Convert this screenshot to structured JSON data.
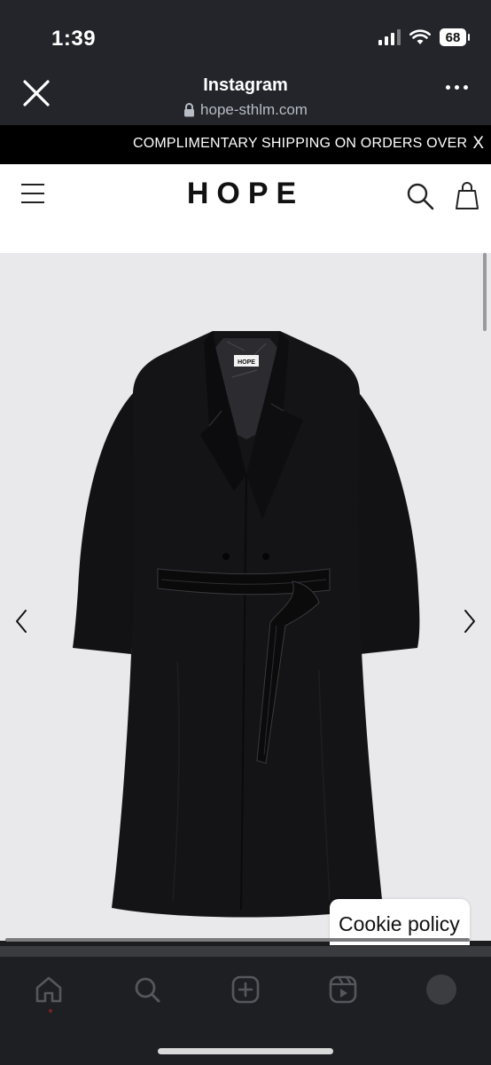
{
  "status_bar": {
    "time": "1:39",
    "battery": "68",
    "signal_icon": "cellular-signal-icon",
    "wifi_icon": "wifi-icon"
  },
  "browser_bar": {
    "title": "Instagram",
    "url": "hope-sthlm.com",
    "close_icon": "close-icon",
    "lock_icon": "lock-icon",
    "more_icon": "more-icon"
  },
  "promo_banner": {
    "text": "COMPLIMENTARY SHIPPING ON ORDERS OVER",
    "close_label": "X"
  },
  "site_header": {
    "logo": "HOPE",
    "menu_icon": "hamburger-menu-icon",
    "search_icon": "search-icon",
    "bag_icon": "shopping-bag-icon"
  },
  "product_gallery": {
    "image": "black-double-breasted-belted-coat",
    "coat_label": "HOPE",
    "prev_icon": "chevron-left-icon",
    "next_icon": "chevron-right-icon"
  },
  "cookie_banner": {
    "label": "Cookie policy"
  },
  "tab_bar": {
    "items": [
      "home-icon",
      "search-icon",
      "create-icon",
      "reels-icon",
      "profile-avatar-icon"
    ]
  },
  "colors": {
    "top_bar": "#23252b",
    "promo_bar": "#000000",
    "header": "#ffffff",
    "product_background": "#e9e9eb",
    "tab_bar": "#1e1f22"
  }
}
